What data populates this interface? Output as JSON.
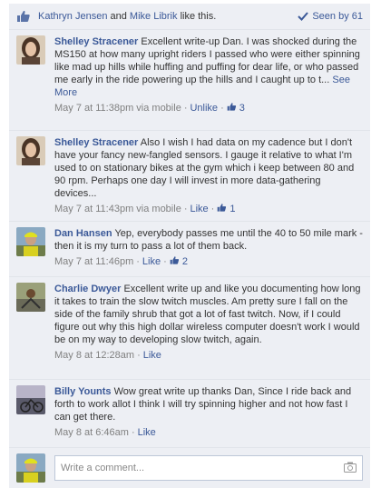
{
  "likes": {
    "name1": "Kathryn Jensen",
    "and": "and",
    "name2": "Mike Librik",
    "suffix": "like this.",
    "seen": "Seen by 61"
  },
  "comments": [
    {
      "author": "Shelley Stracener",
      "text": "Excellent write-up Dan. I was shocked during the MS150 at how many upright riders I passed who were either spinning like mad up hills while huffing and puffing for dear life, or who passed me early in the ride powering up the hills and I caught up to t...",
      "see_more": "See More",
      "time": "May 7 at 11:38pm via mobile",
      "action": "Unlike",
      "likes": "3"
    },
    {
      "author": "Shelley Stracener",
      "text": "Also I wish I had data on my cadence but I don't have your fancy new-fangled sensors. I gauge it relative to what I'm used to on stationary bikes at the gym which i keep between 80 and 90 rpm. Perhaps one day I will invest in more data-gathering devices...",
      "time": "May 7 at 11:43pm via mobile",
      "action": "Like",
      "likes": "1"
    },
    {
      "author": "Dan Hansen",
      "text": "Yep, everybody passes me until the 40 to 50 mile mark - then it is my turn to pass a lot of them back.",
      "time": "May 7 at 11:46pm",
      "action": "Like",
      "likes": "2"
    },
    {
      "author": "Charlie Dwyer",
      "text": "Excellent write up and like you documenting how long it takes to train the slow twitch muscles. Am pretty sure I fall on the side of the family shrub that got a lot of fast twitch. Now, if I could figure out why this high dollar wireless computer doesn't work I would be on my way to developing slow twitch, again.",
      "time": "May 8 at 12:28am",
      "action": "Like",
      "likes": ""
    },
    {
      "author": "Billy Younts",
      "text": "Wow great write up thanks Dan, Since I ride back and forth to work allot I think I will try spinning higher and not how fast I can get there.",
      "time": "May 8 at 6:46am",
      "action": "Like",
      "likes": ""
    }
  ],
  "write": {
    "placeholder": "Write a comment..."
  },
  "colors": {
    "link": "#3b5998",
    "panel": "#edeff4",
    "meta": "#808080"
  }
}
